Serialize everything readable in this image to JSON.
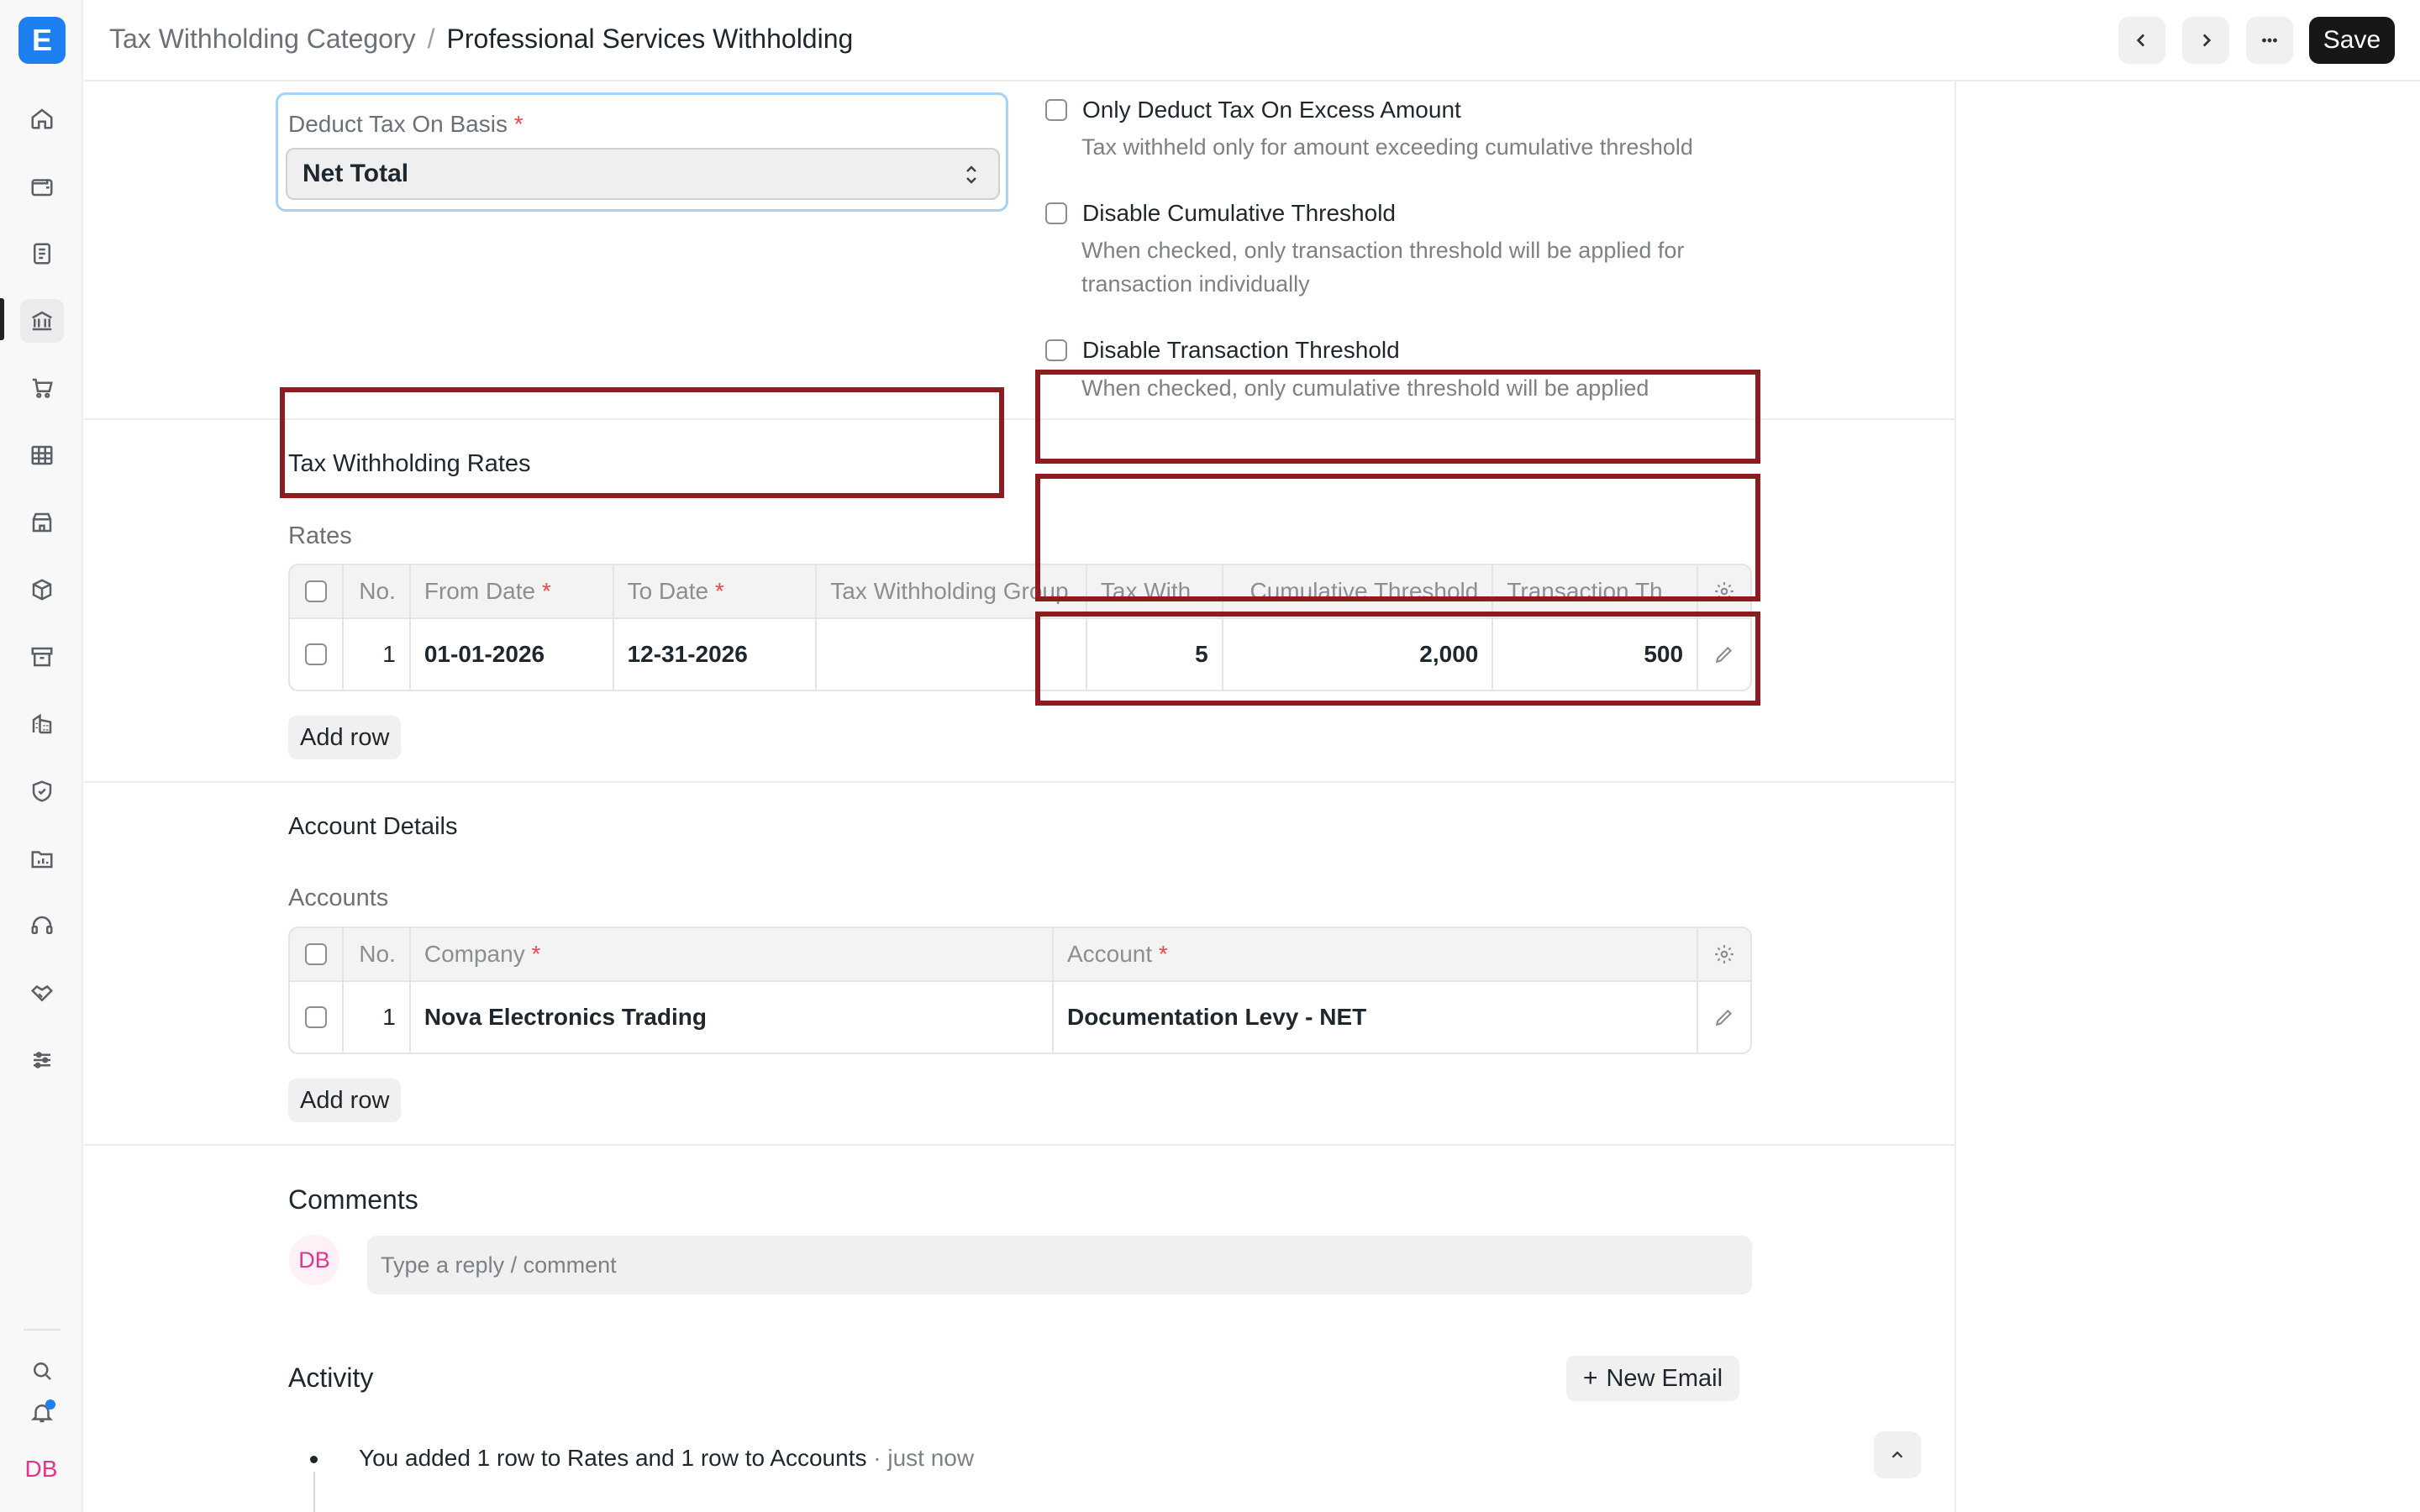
{
  "app": {
    "logo_letter": "E"
  },
  "breadcrumb": {
    "parent": "Tax Withholding Category",
    "separator": "/",
    "current": "Professional Services Withholding"
  },
  "toolbar": {
    "save_label": "Save"
  },
  "fields": {
    "deduct_basis": {
      "label": "Deduct Tax On Basis",
      "required_mark": "*",
      "value": "Net Total"
    },
    "only_excess": {
      "label": "Only Deduct Tax On Excess Amount",
      "description": "Tax withheld only for amount exceeding cumulative threshold",
      "checked": false
    },
    "disable_cumulative": {
      "label": "Disable Cumulative Threshold",
      "description": "When checked, only transaction threshold will be applied for transaction individually",
      "checked": false
    },
    "disable_transaction": {
      "label": "Disable Transaction Threshold",
      "description": "When checked, only cumulative threshold will be applied",
      "checked": false
    }
  },
  "rates_section": {
    "title": "Tax Withholding Rates",
    "table_label": "Rates",
    "columns": [
      "No.",
      "From Date",
      "To Date",
      "Tax Withholding Group",
      "Tax With...",
      "Cumulative Threshold",
      "Transaction Th..."
    ],
    "rows": [
      {
        "no": "1",
        "from_date": "01-01-2026",
        "to_date": "12-31-2026",
        "group": "",
        "rate": "5",
        "cumulative": "2,000",
        "transaction": "500"
      }
    ],
    "add_row": "Add row"
  },
  "account_section": {
    "title": "Account Details",
    "table_label": "Accounts",
    "columns": [
      "No.",
      "Company",
      "Account"
    ],
    "rows": [
      {
        "no": "1",
        "company": "Nova Electronics Trading",
        "account": "Documentation Levy - NET"
      }
    ],
    "add_row": "Add row"
  },
  "comments": {
    "title": "Comments",
    "avatar_initials": "DB",
    "placeholder": "Type a reply / comment"
  },
  "activity": {
    "title": "Activity",
    "new_email": "New Email",
    "items": [
      {
        "text": "You added 1 row to Rates and 1 row to Accounts",
        "time": "· just now"
      }
    ]
  },
  "user": {
    "initials": "DB"
  },
  "colors": {
    "accent": "#1e7ff0",
    "annotation": "#8e1b1f",
    "avatar": "#e0368c"
  }
}
